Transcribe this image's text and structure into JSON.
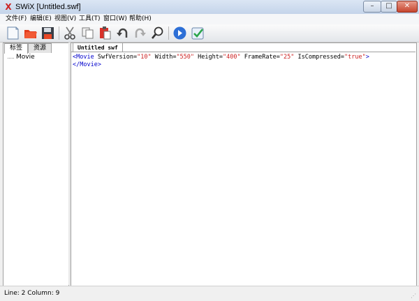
{
  "window": {
    "title": "SWiX [Untitled.swf]",
    "app_icon": "X",
    "min": "–",
    "max": "□",
    "close": "✕"
  },
  "menu": [
    "文件(F)",
    "编辑(E)",
    "视图(V)",
    "工具(T)",
    "窗口(W)",
    "帮助(H)"
  ],
  "toolbar": {
    "buttons": [
      "new-document",
      "open-folder",
      "save-disk",
      "cut-scissors",
      "copy",
      "paste-clipboard",
      "undo",
      "redo",
      "find-magnifier",
      "play-preview",
      "validate-check"
    ]
  },
  "left_panel": {
    "tabs": [
      "标签",
      "资源"
    ],
    "active_tab": 0,
    "tree": [
      "Movie"
    ]
  },
  "editor": {
    "tab_label": "Untitled swf",
    "line1": {
      "open": "<Movie ",
      "attrs": [
        {
          "name": "SwfVersion=",
          "value": "\"10\""
        },
        {
          "name": " Width=",
          "value": "\"550\""
        },
        {
          "name": " Height=",
          "value": "\"400\""
        },
        {
          "name": " FrameRate=",
          "value": "\"25\""
        },
        {
          "name": " IsCompressed=",
          "value": "\"true\""
        }
      ],
      "close": ">"
    },
    "line2": "</Movie>"
  },
  "status": {
    "text": "Line: 2 Column: 9"
  },
  "colors": {
    "tag": "#0000cc",
    "value": "#cc2222",
    "titlebar": "#c4d4ea"
  }
}
